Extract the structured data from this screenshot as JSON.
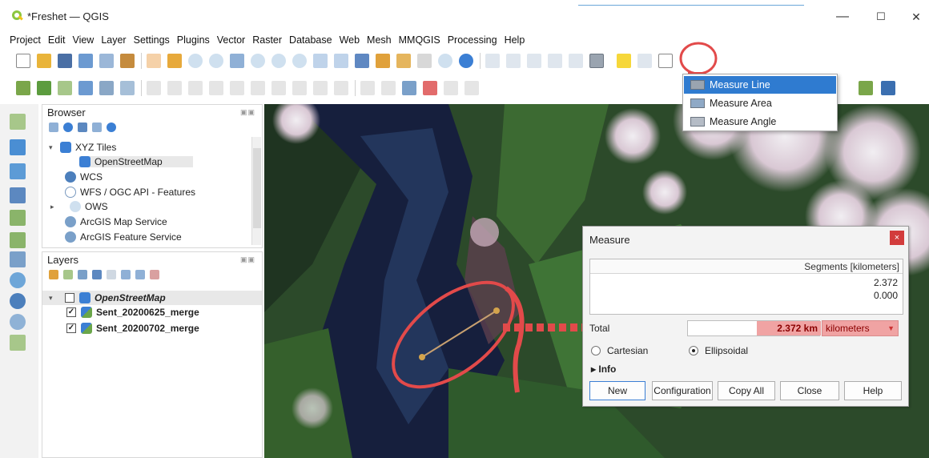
{
  "window": {
    "title": "*Freshet — QGIS",
    "minimize": "—",
    "maximize": "☐",
    "close": "✕"
  },
  "menu": [
    "Project",
    "Edit",
    "View",
    "Layer",
    "Settings",
    "Plugins",
    "Vector",
    "Raster",
    "Database",
    "Web",
    "Mesh",
    "MMQGIS",
    "Processing",
    "Help"
  ],
  "browser": {
    "title": "Browser",
    "items": [
      {
        "label": "XYZ Tiles",
        "expander": "▾"
      },
      {
        "label": "OpenStreetMap"
      },
      {
        "label": "WCS"
      },
      {
        "label": "WFS / OGC API - Features"
      },
      {
        "label": "OWS",
        "expander": "▸"
      },
      {
        "label": "ArcGIS Map Service"
      },
      {
        "label": "ArcGIS Feature Service"
      }
    ]
  },
  "layers": {
    "title": "Layers",
    "items": [
      {
        "label": "OpenStreetMap",
        "checked": false,
        "expander": "▾"
      },
      {
        "label": "Sent_20200625_merge",
        "checked": true
      },
      {
        "label": "Sent_20200702_merge",
        "checked": true
      }
    ]
  },
  "measure_menu": {
    "items": [
      "Measure Line",
      "Measure Area",
      "Measure Angle"
    ]
  },
  "measure_dialog": {
    "title": "Measure",
    "close": "×",
    "segments_header": "Segments [kilometers]",
    "segments": [
      "2.372",
      "0.000"
    ],
    "total_label": "Total",
    "total_value": "2.372 km",
    "unit": "kilometers",
    "radio_cartesian": "Cartesian",
    "radio_ellipsoidal": "Ellipsoidal",
    "info": "Info",
    "info_expander": "▸",
    "buttons": {
      "new": "New",
      "configuration": "Configuration",
      "copy_all": "Copy All",
      "close": "Close",
      "help": "Help"
    }
  },
  "colors": {
    "accent_red": "#e24a4a",
    "highlight_blue": "#2f7bd0",
    "total_bg": "#f0a3a3"
  }
}
